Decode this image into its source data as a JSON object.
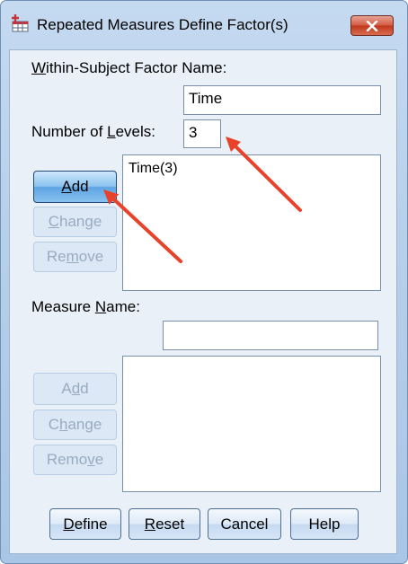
{
  "window": {
    "title": "Repeated Measures Define Factor(s)",
    "app_icon": "spss-table-icon",
    "close_icon": "close-icon"
  },
  "factor": {
    "name_label_ul": "W",
    "name_label_rest": "ithin-Subject Factor Name:",
    "name_value": "Time",
    "levels_label_pre": "Number of ",
    "levels_label_ul": "L",
    "levels_label_post": "evels:",
    "levels_value": "3",
    "list_items": [
      "Time(3)"
    ]
  },
  "factor_buttons": {
    "add_ul": "A",
    "add_rest": "dd",
    "change_ul": "C",
    "change_rest": "hange",
    "remove_pre": "Re",
    "remove_ul": "m",
    "remove_post": "ove"
  },
  "measure": {
    "label_pre": "Measure ",
    "label_ul": "N",
    "label_post": "ame:",
    "name_value": "",
    "list_items": []
  },
  "measure_buttons": {
    "add_pre": "A",
    "add_ul": "d",
    "add_post": "d",
    "change_pre": "C",
    "change_ul": "h",
    "change_post": "ange",
    "remove_pre": "Remo",
    "remove_ul": "v",
    "remove_post": "e"
  },
  "footer": {
    "define_ul": "D",
    "define_rest": "efine",
    "reset_ul": "R",
    "reset_rest": "eset",
    "cancel": "Cancel",
    "help": "Help"
  },
  "annotation_color": "#e8432a"
}
